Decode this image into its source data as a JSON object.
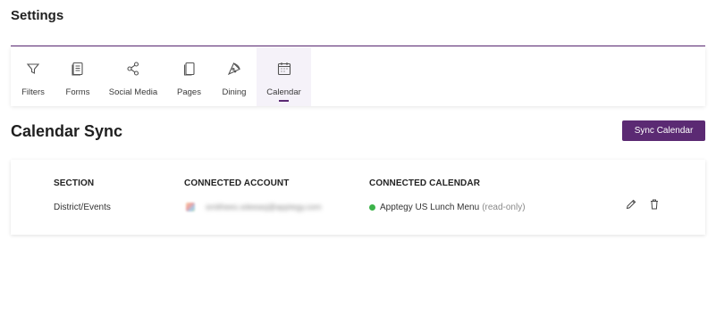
{
  "header": {
    "title": "Settings"
  },
  "tabs": [
    {
      "label": "Filters",
      "icon": "filter-icon"
    },
    {
      "label": "Forms",
      "icon": "form-icon"
    },
    {
      "label": "Social Media",
      "icon": "share-icon"
    },
    {
      "label": "Pages",
      "icon": "pages-icon"
    },
    {
      "label": "Dining",
      "icon": "pizza-icon"
    },
    {
      "label": "Calendar",
      "icon": "calendar-icon",
      "active": true
    }
  ],
  "section": {
    "title": "Calendar Sync",
    "sync_button": "Sync Calendar"
  },
  "table": {
    "columns": [
      "SECTION",
      "CONNECTED ACCOUNT",
      "CONNECTED CALENDAR"
    ],
    "rows": [
      {
        "section": "District/Events",
        "account": "smithees.sdeeasj@apptegy.com",
        "calendar": "Apptegy US Lunch Menu",
        "calendar_note": "(read-only)",
        "status_color": "#3cb34a"
      }
    ]
  },
  "colors": {
    "accent": "#5b2a73"
  }
}
